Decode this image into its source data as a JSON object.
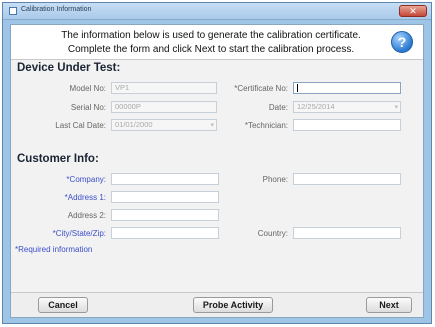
{
  "window": {
    "title": "Calibration Information",
    "close_glyph": "✕"
  },
  "header": {
    "line1": "The information below is used to generate the calibration certificate.",
    "line2": "Complete the form and click Next to start the calibration process.",
    "help_glyph": "?"
  },
  "device": {
    "title": "Device Under Test:",
    "model_label": "Model No:",
    "model_value": "VP1",
    "serial_label": "Serial No:",
    "serial_value": "00000P",
    "last_cal_label": "Last Cal Date:",
    "last_cal_value": "01/01/2000",
    "certificate_label": "*Certificate No:",
    "certificate_value": "",
    "date_label": "Date:",
    "date_value": "12/25/2014",
    "technician_label": "*Technician:",
    "technician_value": ""
  },
  "customer": {
    "title": "Customer Info:",
    "company_label": "*Company:",
    "address1_label": "*Address 1:",
    "address2_label": "Address 2:",
    "city_label": "*City/State/Zip:",
    "phone_label": "Phone:",
    "country_label": "Country:"
  },
  "required_note": "*Required information",
  "buttons": {
    "cancel": "Cancel",
    "probe": "Probe Activity",
    "next": "Next"
  },
  "icons": {
    "help": "help-icon",
    "calendar": "calendar-icon",
    "dropdown": "chevron-down-icon"
  },
  "colors": {
    "required_label": "#3b4fc9",
    "window_frame": "#9ec4e6"
  }
}
